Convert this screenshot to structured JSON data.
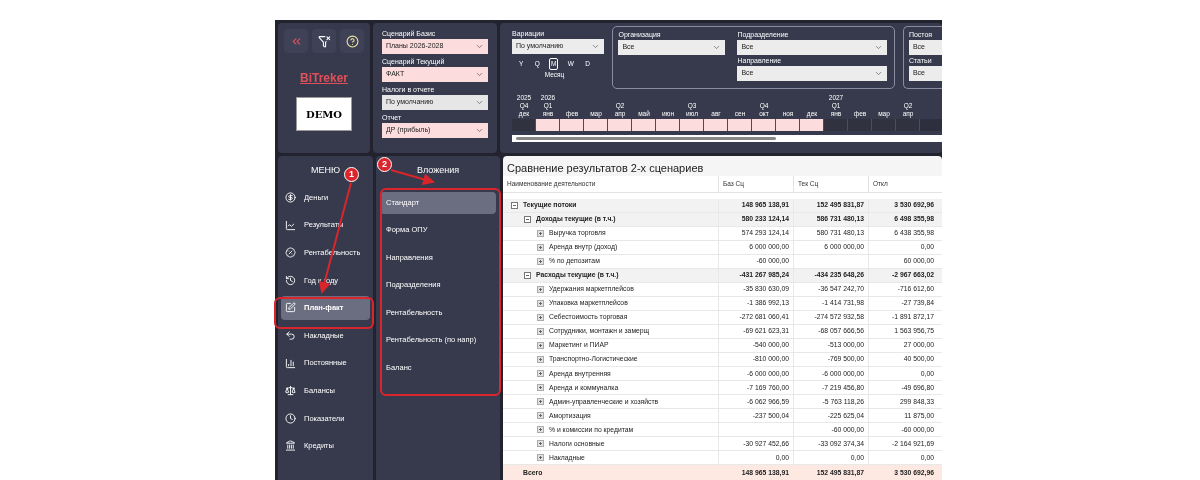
{
  "toolbar": {
    "logo": "BiTreker",
    "demo_badge": "DEMO"
  },
  "scenario_filters": [
    {
      "label": "Сценарий Базис",
      "value": "Планы 2026-2028",
      "highlighted": true
    },
    {
      "label": "Сценарий Текущий",
      "value": "ФАКТ",
      "highlighted": true
    },
    {
      "label": "Налоги в отчете",
      "value": "По умолчанию",
      "highlighted": false
    },
    {
      "label": "Отчет",
      "value": "ДР (прибыль)",
      "highlighted": true
    }
  ],
  "variations": {
    "label": "Вариации",
    "value": "По умолчанию",
    "granularity": [
      {
        "label": "Y",
        "selected": false
      },
      {
        "label": "Q",
        "selected": false
      },
      {
        "label": "M",
        "selected": true
      },
      {
        "label": "W",
        "selected": false
      },
      {
        "label": "D",
        "selected": false
      }
    ],
    "granularity_caption": "Месяц"
  },
  "organization": {
    "label": "Организация",
    "value": "Все"
  },
  "division": {
    "label": "Подразделение",
    "value": "Все"
  },
  "direction": {
    "label": "Направление",
    "value": "Все"
  },
  "cut_filters": [
    {
      "label": "Постоя",
      "value": "Все"
    },
    {
      "label": "Статьи",
      "value": "Все"
    }
  ],
  "timeline": [
    {
      "year": "2025",
      "quarter": "Q4",
      "month": "дек",
      "selected": false
    },
    {
      "year": "2026",
      "quarter": "Q1",
      "month": "янв",
      "selected": true
    },
    {
      "month": "фев",
      "selected": true
    },
    {
      "month": "мар",
      "selected": true
    },
    {
      "quarter": "Q2",
      "month": "апр",
      "selected": true
    },
    {
      "month": "май",
      "selected": true
    },
    {
      "month": "июн",
      "selected": true
    },
    {
      "quarter": "Q3",
      "month": "июл",
      "selected": true
    },
    {
      "month": "авг",
      "selected": true
    },
    {
      "month": "сен",
      "selected": true
    },
    {
      "quarter": "Q4",
      "month": "окт",
      "selected": true
    },
    {
      "month": "ноя",
      "selected": true
    },
    {
      "month": "дек",
      "selected": true
    },
    {
      "year": "2027",
      "quarter": "Q1",
      "month": "янв",
      "selected": false
    },
    {
      "month": "фев",
      "selected": false
    },
    {
      "month": "мар",
      "selected": false
    },
    {
      "quarter": "Q2",
      "month": "апр",
      "selected": false
    }
  ],
  "menu": {
    "title": "МЕНЮ",
    "items": [
      {
        "label": "Деньги",
        "selected": false
      },
      {
        "label": "Результаты",
        "selected": false
      },
      {
        "label": "Рентабельность",
        "selected": false
      },
      {
        "label": "Год к году",
        "selected": false
      },
      {
        "label": "План-факт",
        "selected": true
      },
      {
        "label": "Накладные",
        "selected": false
      },
      {
        "label": "Постоянные",
        "selected": false
      },
      {
        "label": "Балансы",
        "selected": false
      },
      {
        "label": "Показатели",
        "selected": false
      },
      {
        "label": "Кредиты",
        "selected": false
      }
    ]
  },
  "submenu": {
    "title": "Вложения",
    "items": [
      {
        "label": "Стандарт",
        "selected": true
      },
      {
        "label": "Форма ОПУ",
        "selected": false
      },
      {
        "label": "Направления",
        "selected": false
      },
      {
        "label": "Подразделения",
        "selected": false
      },
      {
        "label": "Рентабельность",
        "selected": false
      },
      {
        "label": "Рентабельность (по напр)",
        "selected": false
      },
      {
        "label": "Баланс",
        "selected": false
      }
    ]
  },
  "table": {
    "title": "Сравнение результатов 2-х сценариев",
    "columns": [
      "Наименование деятельности",
      "Баз Сц",
      "Тек Сц",
      "Откл"
    ],
    "rows": [
      {
        "name": "Текущие потоки",
        "base": "148 965 138,91",
        "current": "152 495 831,87",
        "diff": "3 530 692,96",
        "expanded": true,
        "children": [
          {
            "name": "Доходы текущие (в т.ч.)",
            "base": "580 233 124,14",
            "current": "586 731 480,13",
            "diff": "6 498 355,98",
            "expanded": true,
            "children": [
              {
                "name": "Выручка торговля",
                "base": "574 293 124,14",
                "current": "580 731 480,13",
                "diff": "6 438 355,98",
                "expanded": false
              },
              {
                "name": "Аренда внутр (доход)",
                "base": "6 000 000,00",
                "current": "6 000 000,00",
                "diff": "0,00",
                "expanded": false
              },
              {
                "name": "% по депозитам",
                "base": "-60 000,00",
                "diff": "60 000,00",
                "expanded": false
              }
            ]
          },
          {
            "name": "Расходы текущие (в т.ч.)",
            "base": "-431 267 985,24",
            "current": "-434 235 648,26",
            "diff": "-2 967 663,02",
            "expanded": true,
            "children": [
              {
                "name": "Удержания маркетплейсов",
                "base": "-35 830 630,09",
                "current": "-36 547 242,70",
                "diff": "-716 612,60",
                "expanded": false
              },
              {
                "name": "Упаковка маркетплейсов",
                "base": "-1 386 992,13",
                "current": "-1 414 731,98",
                "diff": "-27 739,84",
                "expanded": false
              },
              {
                "name": "Себестоимость торговая",
                "base": "-272 681 060,41",
                "current": "-274 572 932,58",
                "diff": "-1 891 872,17",
                "expanded": false
              },
              {
                "name": "Сотрудники, монтажн и замерщ",
                "base": "-69 621 623,31",
                "current": "-68 057 666,56",
                "diff": "1 563 956,75",
                "expanded": false
              },
              {
                "name": "Маркетинг и ПИАР",
                "base": "-540 000,00",
                "current": "-513 000,00",
                "diff": "27 000,00",
                "expanded": false
              },
              {
                "name": "Транспортно-Логистические",
                "base": "-810 000,00",
                "current": "-769 500,00",
                "diff": "40 500,00",
                "expanded": false
              },
              {
                "name": "Аренда внутренняя",
                "base": "-6 000 000,00",
                "current": "-6 000 000,00",
                "diff": "0,00",
                "expanded": false
              },
              {
                "name": "Аренда и коммуналка",
                "base": "-7 169 760,00",
                "current": "-7 219 456,80",
                "diff": "-49 696,80",
                "expanded": false
              },
              {
                "name": "Админ-управленческие и хозяйств",
                "base": "-6 062 966,59",
                "current": "-5 763 118,26",
                "diff": "299 848,33",
                "expanded": false
              },
              {
                "name": "Амортизация",
                "base": "-237 500,04",
                "current": "-225 625,04",
                "diff": "11 875,00",
                "expanded": false
              },
              {
                "name": "% и комиссии по кредитам",
                "current": "-60 000,00",
                "diff": "-60 000,00",
                "expanded": false
              },
              {
                "name": "Налоги основные",
                "base": "-30 927 452,66",
                "current": "-33 092 374,34",
                "diff": "-2 164 921,69",
                "expanded": false
              },
              {
                "name": "Накладные",
                "base": "0,00",
                "current": "0,00",
                "diff": "0,00",
                "expanded": false
              }
            ]
          }
        ]
      }
    ],
    "total": {
      "name": "Всего",
      "base": "148 965 138,91",
      "current": "152 495 831,87",
      "diff": "3 530 692,96"
    }
  },
  "annotations": [
    {
      "label": "1"
    },
    {
      "label": "2"
    }
  ]
}
